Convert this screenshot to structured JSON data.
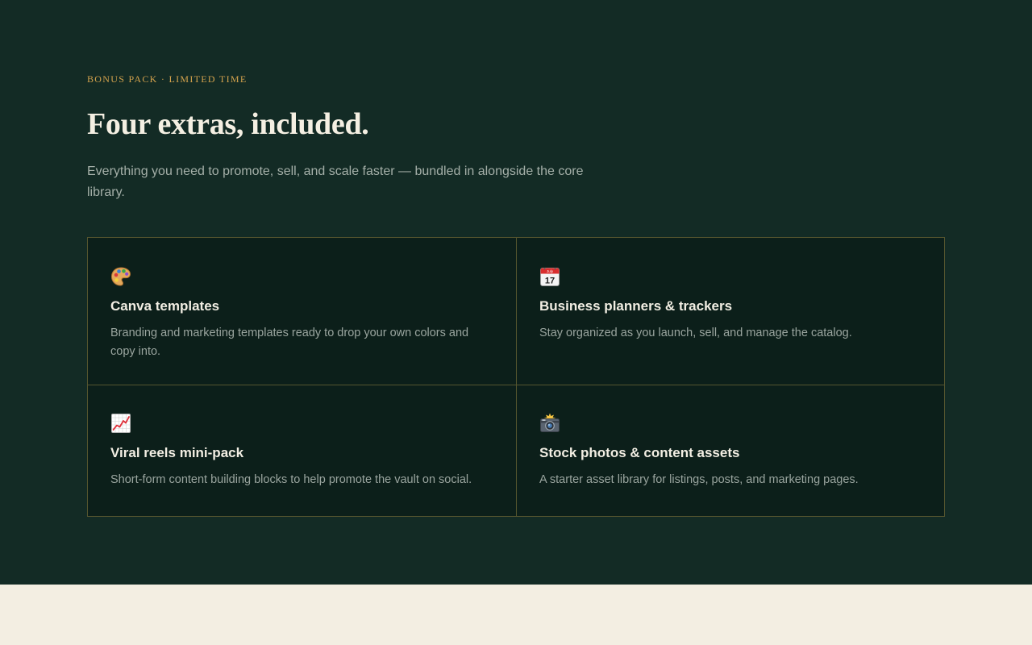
{
  "bonus_section": {
    "eyebrow": "BONUS PACK · LIMITED TIME",
    "title": "Four extras, included.",
    "intro": "Everything you need to promote, sell, and scale faster — bundled in alongside the core library.",
    "colors": {
      "background": "#132b25",
      "card_background": "#0c1f1a",
      "accent": "#d3a24d",
      "border": "#55552f",
      "page_background": "#f3eee2"
    },
    "cards": [
      {
        "icon": "palette-icon",
        "title": "Canva templates",
        "description": "Branding and marketing templates ready to drop your own colors and copy into."
      },
      {
        "icon": "calendar-icon",
        "title": "Business planners & trackers",
        "description": "Stay organized as you launch, sell, and manage the catalog."
      },
      {
        "icon": "chart-increasing-icon",
        "title": "Viral reels mini-pack",
        "description": "Short-form content building blocks to help promote the vault on social."
      },
      {
        "icon": "camera-flash-icon",
        "title": "Stock photos & content assets",
        "description": "A starter asset library for listings, posts, and marketing pages."
      }
    ]
  },
  "calendar_icon_text": {
    "month": "July",
    "day": "17"
  }
}
